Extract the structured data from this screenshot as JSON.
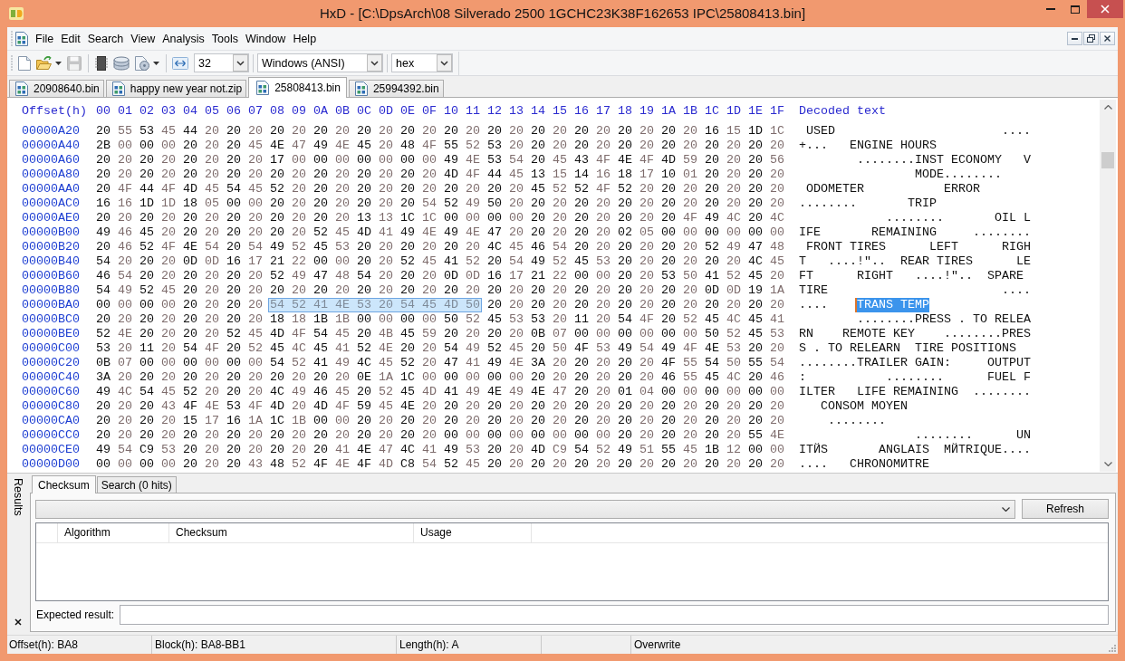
{
  "window": {
    "title": "HxD - [C:\\DpsArch\\08 Silverado 2500 1GCHC23K38F162653 IPC\\25808413.bin]"
  },
  "menu": [
    "File",
    "Edit",
    "Search",
    "View",
    "Analysis",
    "Tools",
    "Window",
    "Help"
  ],
  "toolbar": {
    "button_groups": [
      [
        {
          "kind": "new",
          "dropdown": false,
          "disabled": false
        },
        {
          "kind": "open",
          "dropdown": true,
          "disabled": false
        },
        {
          "kind": "save",
          "dropdown": false,
          "disabled": true
        }
      ],
      [
        {
          "kind": "memory",
          "dropdown": false,
          "disabled": false
        },
        {
          "kind": "disk",
          "dropdown": false,
          "disabled": false
        },
        {
          "kind": "document",
          "dropdown": true,
          "disabled": false
        }
      ]
    ],
    "combos": [
      {
        "value": "32"
      },
      {
        "value": "Windows (ANSI)"
      },
      {
        "value": "hex"
      }
    ]
  },
  "tabs": [
    {
      "label": "20908640.bin",
      "selected": false
    },
    {
      "label": "happy new year not.zip",
      "selected": false
    },
    {
      "label": "25808413.bin",
      "selected": true
    },
    {
      "label": "25994392.bin",
      "selected": false
    }
  ],
  "hex_view": {
    "offset_header": "Offset(h)",
    "column_headers": [
      "00",
      "01",
      "02",
      "03",
      "04",
      "05",
      "06",
      "07",
      "08",
      "09",
      "0A",
      "0B",
      "0C",
      "0D",
      "0E",
      "0F",
      "10",
      "11",
      "12",
      "13",
      "14",
      "15",
      "16",
      "17",
      "18",
      "19",
      "1A",
      "1B",
      "1C",
      "1D",
      "1E",
      "1F"
    ],
    "text_header": "Decoded text",
    "rows": [
      {
        "offset": "00000A20",
        "hex": [
          {
            "bytes": "20 55 53 45 44 20 20 20 20 20 20 20 20 20 20 20 20 20 20 20 20 20 20 20 20 20 20 20 16 15 1D 1C",
            "selected": false
          }
        ],
        "text": [
          {
            "chars": " USED                       ....",
            "selected": false
          }
        ]
      },
      {
        "offset": "00000A40",
        "hex": [
          {
            "bytes": "2B 00 00 00 20 20 20 45 4E 47 49 4E 45 20 48 4F 55 52 53 20 20 20 20 20 20 20 20 20 20 20 20 20",
            "selected": false
          }
        ],
        "text": [
          {
            "chars": "+...   ENGINE HOURS",
            "selected": false
          }
        ]
      },
      {
        "offset": "00000A60",
        "hex": [
          {
            "bytes": "20 20 20 20 20 20 20 20 17 00 00 00 00 00 00 00 49 4E 53 54 20 45 43 4F 4E 4F 4D 59 20 20 20 56",
            "selected": false
          }
        ],
        "text": [
          {
            "chars": "        ........INST ECONOMY   V",
            "selected": false
          }
        ]
      },
      {
        "offset": "00000A80",
        "hex": [
          {
            "bytes": "20 20 20 20 20 20 20 20 20 20 20 20 20 20 20 20 4D 4F 44 45 13 15 14 16 18 17 10 01 20 20 20 20",
            "selected": false
          }
        ],
        "text": [
          {
            "chars": "                MODE........",
            "selected": false
          }
        ]
      },
      {
        "offset": "00000AA0",
        "hex": [
          {
            "bytes": "20 4F 44 4F 4D 45 54 45 52 20 20 20 20 20 20 20 20 20 20 20 45 52 52 4F 52 20 20 20 20 20 20 20",
            "selected": false
          }
        ],
        "text": [
          {
            "chars": " ODOMETER           ERROR",
            "selected": false
          }
        ]
      },
      {
        "offset": "00000AC0",
        "hex": [
          {
            "bytes": "16 16 1D 1D 18 05 00 00 20 20 20 20 20 20 20 54 52 49 50 20 20 20 20 20 20 20 20 20 20 20 20 20",
            "selected": false
          }
        ],
        "text": [
          {
            "chars": "........       TRIP",
            "selected": false
          }
        ]
      },
      {
        "offset": "00000AE0",
        "hex": [
          {
            "bytes": "20 20 20 20 20 20 20 20 20 20 20 20 13 13 1C 1C 00 00 00 00 20 20 20 20 20 20 20 4F 49 4C 20 4C",
            "selected": false
          }
        ],
        "text": [
          {
            "chars": "            ........       OIL L",
            "selected": false
          }
        ]
      },
      {
        "offset": "00000B00",
        "hex": [
          {
            "bytes": "49 46 45 20 20 20 20 20 20 20 52 45 4D 41 49 4E 49 4E 47 20 20 20 20 20 02 05 00 00 00 00 00 00",
            "selected": false
          }
        ],
        "text": [
          {
            "chars": "IFE       REMAINING     ........",
            "selected": false
          }
        ]
      },
      {
        "offset": "00000B20",
        "hex": [
          {
            "bytes": "20 46 52 4F 4E 54 20 54 49 52 45 53 20 20 20 20 20 20 4C 45 46 54 20 20 20 20 20 20 52 49 47 48",
            "selected": false
          }
        ],
        "text": [
          {
            "chars": " FRONT TIRES      LEFT      RIGH",
            "selected": false
          }
        ]
      },
      {
        "offset": "00000B40",
        "hex": [
          {
            "bytes": "54 20 20 20 0D 0D 16 17 21 22 00 00 20 20 52 45 41 52 20 54 49 52 45 53 20 20 20 20 20 20 4C 45",
            "selected": false
          }
        ],
        "text": [
          {
            "chars": "T   ....!\"..  REAR TIRES      LE",
            "selected": false
          }
        ]
      },
      {
        "offset": "00000B60",
        "hex": [
          {
            "bytes": "46 54 20 20 20 20 20 20 52 49 47 48 54 20 20 20 0D 0D 16 17 21 22 00 00 20 20 53 50 41 52 45 20",
            "selected": false
          }
        ],
        "text": [
          {
            "chars": "FT      RIGHT   ....!\"..  SPARE",
            "selected": false
          }
        ]
      },
      {
        "offset": "00000B80",
        "hex": [
          {
            "bytes": "54 49 52 45 20 20 20 20 20 20 20 20 20 20 20 20 20 20 20 20 20 20 20 20 20 20 20 20 0D 0D 19 1A",
            "selected": false
          }
        ],
        "text": [
          {
            "chars": "TIRE                        ....",
            "selected": false
          }
        ]
      },
      {
        "offset": "00000BA0",
        "hex": [
          {
            "bytes": "00 00 00 00 20 20 20 20",
            "selected": false
          },
          {
            "bytes": "54 52 41 4E 53 20 54 45 4D 50",
            "selected": true
          },
          {
            "bytes": "20 20 20 20 20 20 20 20 20 20 20 20 20 20",
            "selected": false
          }
        ],
        "text": [
          {
            "chars": "....    ",
            "selected": false
          },
          {
            "chars": "TRANS TEMP",
            "selected": true
          }
        ]
      },
      {
        "offset": "00000BC0",
        "hex": [
          {
            "bytes": "20 20 20 20 20 20 20 20 18 18 1B 1B 00 00 00 00 50 52 45 53 53 20 11 20 54 4F 20 52 45 4C 45 41",
            "selected": false
          }
        ],
        "text": [
          {
            "chars": "        ........PRESS . TO RELEA",
            "selected": false
          }
        ]
      },
      {
        "offset": "00000BE0",
        "hex": [
          {
            "bytes": "52 4E 20 20 20 20 52 45 4D 4F 54 45 20 4B 45 59 20 20 20 20 0B 07 00 00 00 00 00 00 50 52 45 53",
            "selected": false
          }
        ],
        "text": [
          {
            "chars": "RN    REMOTE KEY    ........PRES",
            "selected": false
          }
        ]
      },
      {
        "offset": "00000C00",
        "hex": [
          {
            "bytes": "53 20 11 20 54 4F 20 52 45 4C 45 41 52 4E 20 20 54 49 52 45 20 50 4F 53 49 54 49 4F 4E 53 20 20",
            "selected": false
          }
        ],
        "text": [
          {
            "chars": "S . TO RELEARN  TIRE POSITIONS",
            "selected": false
          }
        ]
      },
      {
        "offset": "00000C20",
        "hex": [
          {
            "bytes": "0B 07 00 00 00 00 00 00 54 52 41 49 4C 45 52 20 47 41 49 4E 3A 20 20 20 20 20 4F 55 54 50 55 54",
            "selected": false
          }
        ],
        "text": [
          {
            "chars": "........TRAILER GAIN:     OUTPUT",
            "selected": false
          }
        ]
      },
      {
        "offset": "00000C40",
        "hex": [
          {
            "bytes": "3A 20 20 20 20 20 20 20 20 20 20 20 0E 1A 1C 00 00 00 00 00 20 20 20 20 20 20 46 55 45 4C 20 46",
            "selected": false
          }
        ],
        "text": [
          {
            "chars": ":           ........      FUEL F",
            "selected": false
          }
        ]
      },
      {
        "offset": "00000C60",
        "hex": [
          {
            "bytes": "49 4C 54 45 52 20 20 20 4C 49 46 45 20 52 45 4D 41 49 4E 49 4E 47 20 20 01 04 00 00 00 00 00 00",
            "selected": false
          }
        ],
        "text": [
          {
            "chars": "ILTER   LIFE REMAINING  ........",
            "selected": false
          }
        ]
      },
      {
        "offset": "00000C80",
        "hex": [
          {
            "bytes": "20 20 20 43 4F 4E 53 4F 4D 20 4D 4F 59 45 4E 20 20 20 20 20 20 20 20 20 20 20 20 20 20 20 20 20",
            "selected": false
          }
        ],
        "text": [
          {
            "chars": "   CONSOM MOYEN",
            "selected": false
          }
        ]
      },
      {
        "offset": "00000CA0",
        "hex": [
          {
            "bytes": "20 20 20 20 15 17 16 1A 1C 1B 00 00 20 20 20 20 20 20 20 20 20 20 20 20 20 20 20 20 20 20 20 20",
            "selected": false
          }
        ],
        "text": [
          {
            "chars": "    ........",
            "selected": false
          }
        ]
      },
      {
        "offset": "00000CC0",
        "hex": [
          {
            "bytes": "20 20 20 20 20 20 20 20 20 20 20 20 20 20 20 20 00 00 00 00 00 00 00 00 20 20 20 20 20 20 55 4E",
            "selected": false
          }
        ],
        "text": [
          {
            "chars": "                ........      UN",
            "selected": false
          }
        ]
      },
      {
        "offset": "00000CE0",
        "hex": [
          {
            "bytes": "49 54 C9 53 20 20 20 20 20 20 20 41 4E 47 4C 41 49 53 20 20 4D C9 54 52 49 51 55 45 1B 12 00 00",
            "selected": false
          }
        ],
        "text": [
          {
            "chars": "ITЙS       ANGLAIS  MЙTRIQUE....",
            "selected": false
          }
        ]
      },
      {
        "offset": "00000D00",
        "hex": [
          {
            "bytes": "00 00 00 00 20 20 20 43 48 52 4F 4E 4F 4D C8 54 52 45 20 20 20 20 20 20 20 20 20 20 20 20 20 20",
            "selected": false
          }
        ],
        "text": [
          {
            "chars": "....   CHRONOMИTRE",
            "selected": false
          }
        ]
      }
    ]
  },
  "results_panel": {
    "title": "Results",
    "tabs": [
      {
        "label": "Checksum",
        "selected": true
      },
      {
        "label": "Search (0 hits)",
        "selected": false
      }
    ],
    "button": "Refresh",
    "table": {
      "columns": [
        "Algorithm",
        "Checksum",
        "Usage"
      ]
    },
    "expected_result": {
      "label": "Expected result:"
    }
  },
  "status_bar": [
    "Offset(h): BA8",
    "Block(h): BA8-BB1",
    "Length(h): A",
    "Overwrite"
  ]
}
